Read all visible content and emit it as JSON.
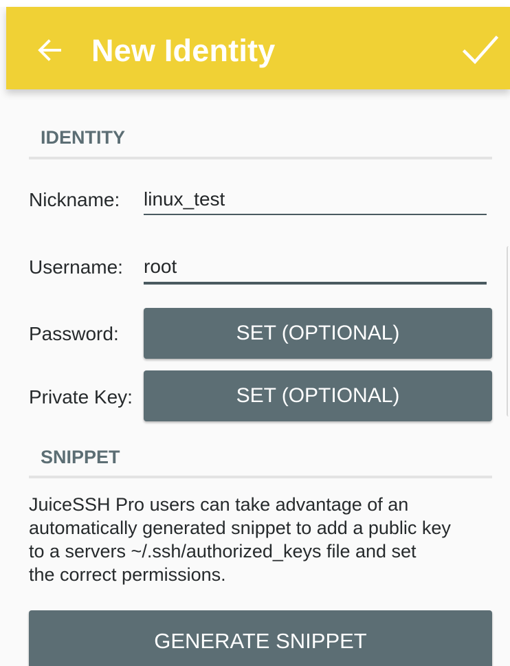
{
  "toolbar": {
    "title": "New Identity",
    "back_icon": "arrow-back-icon",
    "save_icon": "checkmark-icon",
    "background_color": "#f0d135"
  },
  "identity_section": {
    "header": "IDENTITY",
    "nickname": {
      "label": "Nickname:",
      "value": "linux_test"
    },
    "username": {
      "label": "Username:",
      "value": "root"
    },
    "password": {
      "label": "Password:",
      "button_label": "SET (OPTIONAL)"
    },
    "private_key": {
      "label": "Private Key:",
      "button_label": "SET (OPTIONAL)"
    }
  },
  "snippet_section": {
    "header": "SNIPPET",
    "description_lines": [
      "JuiceSSH Pro users can take advantage of an",
      "automatically generated snippet to add a public key",
      "to a servers ~/.ssh/authorized_keys file and set",
      "the correct permissions."
    ],
    "button_label": "GENERATE SNIPPET"
  },
  "colors": {
    "accent": "#f0d135",
    "button": "#5c6e74",
    "section_header": "#5c6e74"
  }
}
